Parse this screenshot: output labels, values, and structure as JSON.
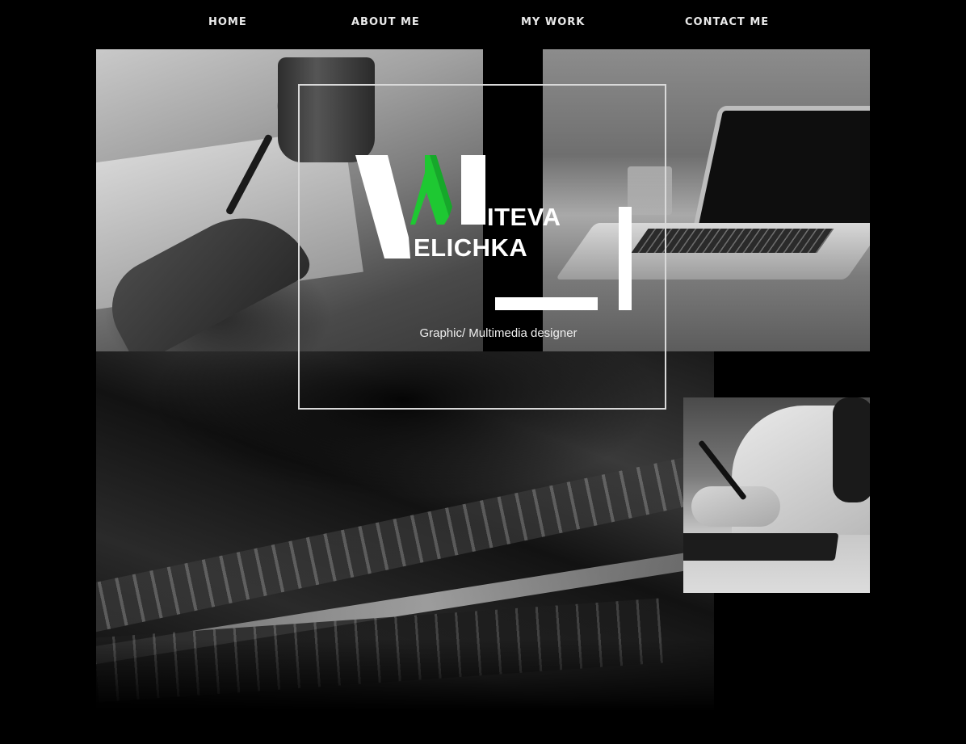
{
  "nav": {
    "items": [
      {
        "label": "HOME"
      },
      {
        "label": "ABOUT ME"
      },
      {
        "label": "MY WORK"
      },
      {
        "label": "CONTACT ME"
      }
    ]
  },
  "hero": {
    "logo": {
      "first_letter_white": "V",
      "first_letter_green": "M",
      "word_top": "ITEVA",
      "word_bottom": "ELICHKA",
      "accent_color": "#1ec832"
    },
    "tagline": "Graphic/ Multimedia designer"
  },
  "images": {
    "desk": "desk-writing-photo",
    "laptop": "laptop-on-table-photo",
    "keyboard": "keyboard-closeup-photo",
    "tablet": "drawing-tablet-photo"
  }
}
